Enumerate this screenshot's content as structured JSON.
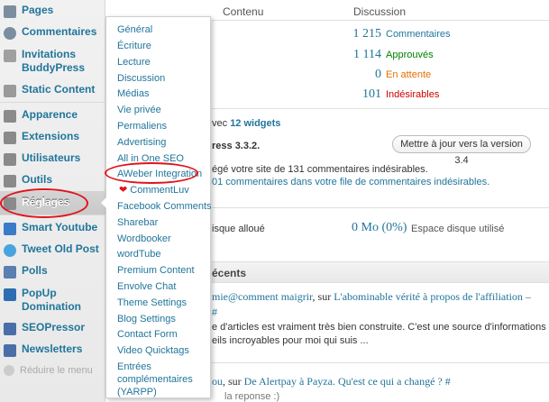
{
  "sidebar": {
    "items": [
      {
        "label": "Pages",
        "icon": "pages-icon",
        "color": "#7a8ea0"
      },
      {
        "label": "Commentaires",
        "icon": "comments-icon",
        "color": "#7a8ea0"
      },
      {
        "label": "Invitations BuddyPress",
        "icon": "invitations-icon",
        "color": "#a0a0a0"
      },
      {
        "label": "Static Content",
        "icon": "static-content-icon",
        "color": "#9a9a9a"
      },
      {
        "label": "Apparence",
        "icon": "appearance-icon",
        "color": "#8a8a8a"
      },
      {
        "label": "Extensions",
        "icon": "plugins-icon",
        "color": "#8a8a8a"
      },
      {
        "label": "Utilisateurs",
        "icon": "users-icon",
        "color": "#8a8a8a"
      },
      {
        "label": "Outils",
        "icon": "tools-icon",
        "color": "#8a8a8a"
      },
      {
        "label": "Réglages",
        "icon": "settings-icon",
        "color": "#8a8a8a"
      },
      {
        "label": "Smart Youtube",
        "icon": "youtube-icon",
        "color": "#3a7bc8"
      },
      {
        "label": "Tweet Old Post",
        "icon": "twitter-icon",
        "color": "#4aa3df"
      },
      {
        "label": "Polls",
        "icon": "polls-icon",
        "color": "#5a7fb0"
      },
      {
        "label": "PopUp Domination",
        "icon": "popup-icon",
        "color": "#2f6db3"
      },
      {
        "label": "SEOPressor",
        "icon": "seopressor-icon",
        "color": "#4a6fa8"
      },
      {
        "label": "Newsletters",
        "icon": "newsletters-icon",
        "color": "#4a6fa8"
      }
    ],
    "collapse_label": "Réduire le menu"
  },
  "submenu": {
    "items": [
      "Général",
      "Écriture",
      "Lecture",
      "Discussion",
      "Médias",
      "Vie privée",
      "Permaliens",
      "Advertising",
      "All in One SEO",
      "AWeber Integration",
      "CommentLuv",
      "Facebook Comments",
      "Sharebar",
      "Wordbooker",
      "wordTube",
      "Premium Content",
      "Envolve Chat",
      "Theme Settings",
      "Blog Settings",
      "Contact Form",
      "Video Quicktags",
      "Entrées complémentaires (YARPP)"
    ]
  },
  "main": {
    "contenu_header": "Contenu",
    "discussion_header": "Discussion",
    "stats": [
      {
        "num": "1 215",
        "label": "Commentaires",
        "color": "#21759b"
      },
      {
        "num": "1 114",
        "label": "Approuvés",
        "color": "#008000"
      },
      {
        "num": "0",
        "label": "En attente",
        "color": "#e66f00"
      },
      {
        "num": "101",
        "label": "Indésirables",
        "color": "#cc0000"
      }
    ],
    "theme_prefix": "vec",
    "theme_widgets": "12 widgets",
    "wp_version": "ress 3.3.2.",
    "update_button": "Mettre à jour vers la version 3.4",
    "akismet_line1": "égé votre site de 131 commentaires indésirables.",
    "akismet_line2": "01 commentaires dans votre file de commentaires indésirables.",
    "disk_allowed": "isque alloué",
    "disk_used_num": "0 Mo (0%)",
    "disk_used_label": "Espace disque utilisé",
    "recent_title": "écents",
    "comment1_author": "mie@comment maigrir",
    "comment1_sur": ", sur ",
    "comment1_post": "L'abominable vérité à propos de l'affiliation –",
    "comment1_hash": "#",
    "comment1_text1": "e d'articles est vraiment très bien construite. C'est une source d'informations et",
    "comment1_text2": "eils incroyables pour moi qui suis ...",
    "comment2_author": "ou",
    "comment2_sur": ", sur ",
    "comment2_post": "De Alertpay à Payza. Qu'est ce qui a changé ?",
    "comment2_hash": "#",
    "comment2_text": "la reponse :)"
  }
}
